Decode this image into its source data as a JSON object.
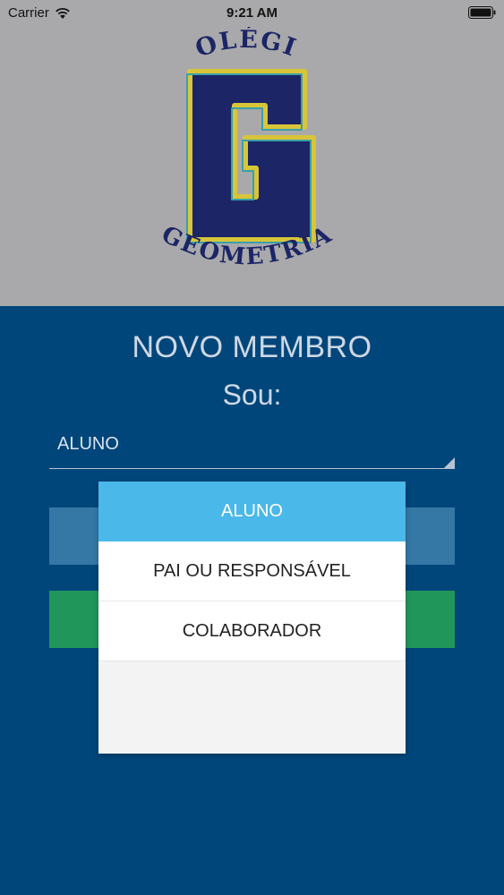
{
  "status_bar": {
    "carrier": "Carrier",
    "time": "9:21 AM"
  },
  "logo": {
    "top_text": "COLÉGIO",
    "letter": "G",
    "bottom_text": "GEOMETRIA",
    "colors": {
      "navy": "#1c2566",
      "gold": "#d8c53a",
      "teal": "#3aa0a8"
    }
  },
  "form": {
    "title": "NOVO MEMBRO",
    "subtitle": "Sou:",
    "select_value": "ALUNO"
  },
  "dropdown": {
    "options": [
      {
        "label": "ALUNO",
        "selected": true
      },
      {
        "label": "PAI OU RESPONSÁVEL",
        "selected": false
      },
      {
        "label": "COLABORADOR",
        "selected": false
      }
    ]
  },
  "colors": {
    "header_bg": "#a9a9ab",
    "main_bg": "#00467a",
    "selected_option": "#4ab8e8",
    "button_blue": "#3578a5",
    "button_green": "#21965a"
  }
}
